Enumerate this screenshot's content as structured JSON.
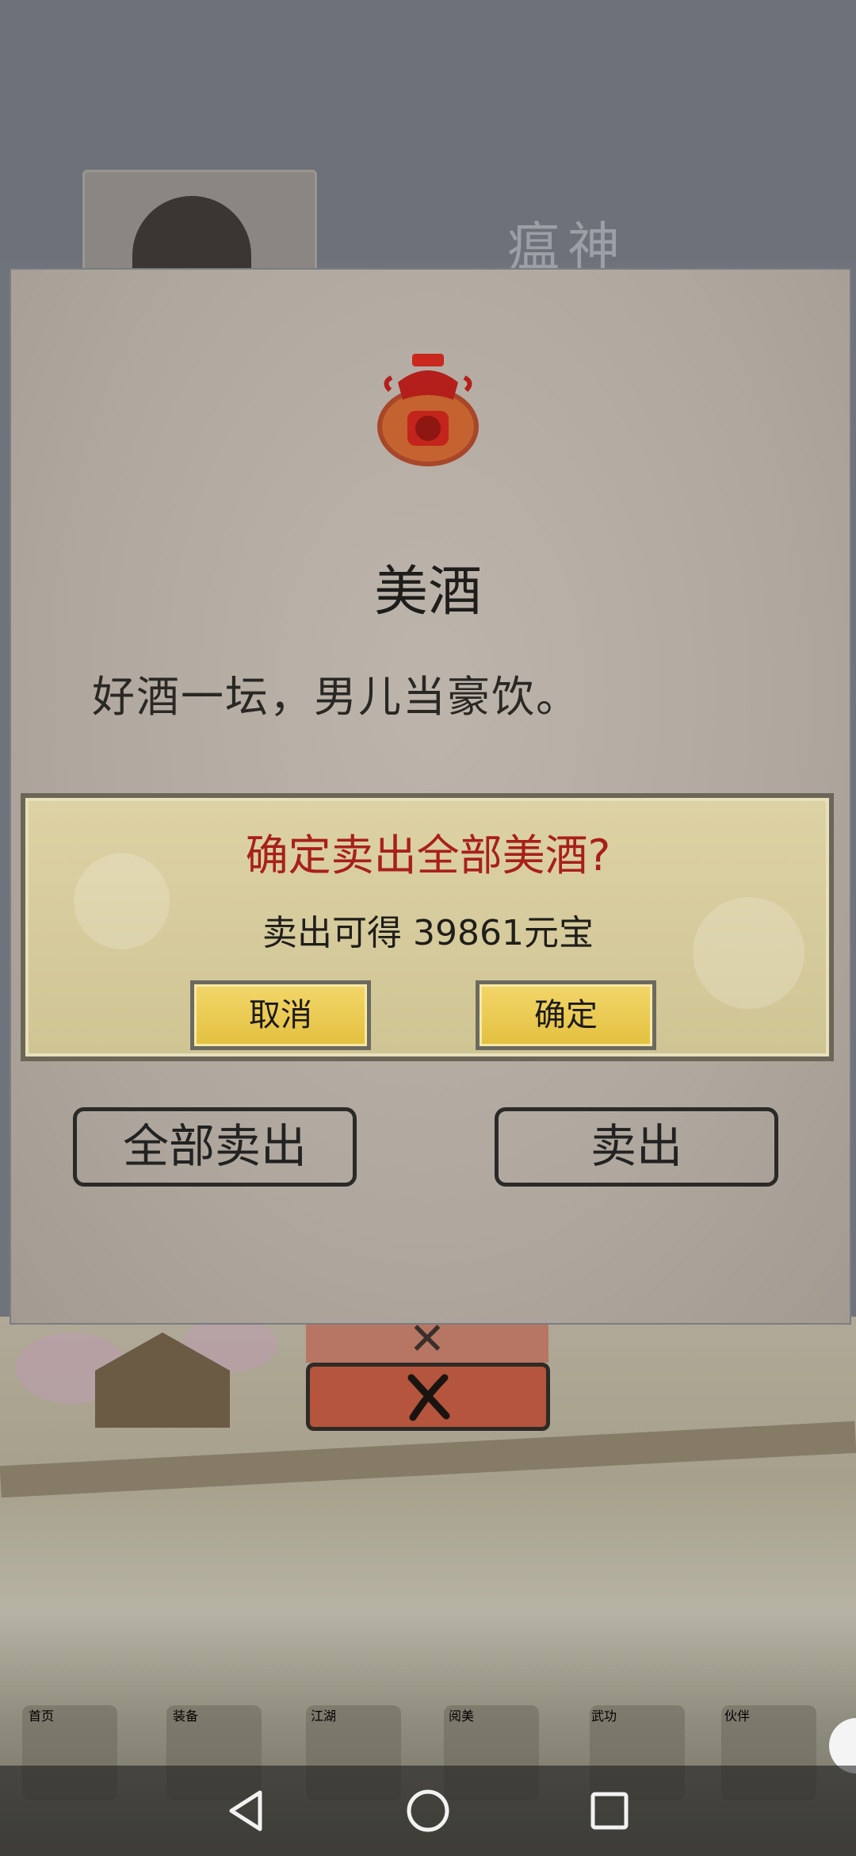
{
  "background": {
    "header_title": "瘟神",
    "nav_labels": [
      "首页",
      "装备",
      "江湖",
      "阅美",
      "武功",
      "伙伴"
    ]
  },
  "item": {
    "name": "美酒",
    "description": "好酒一坛，男儿当豪饮。",
    "icon": "wine-jar-icon"
  },
  "confirm_dialog": {
    "title": "确定卖出全部美酒?",
    "message": "卖出可得 39861元宝",
    "cancel_label": "取消",
    "confirm_label": "确定"
  },
  "actions": {
    "sell_all_label": "全部卖出",
    "sell_label": "卖出",
    "close_icon": "close-icon"
  },
  "system_nav": {
    "back_icon": "back-triangle-icon",
    "home_icon": "home-circle-icon",
    "recents_icon": "recents-square-icon"
  },
  "colors": {
    "dialog_title": "#a8201a",
    "button_yellow": "#e3c03f",
    "close_red": "#b5553d"
  }
}
